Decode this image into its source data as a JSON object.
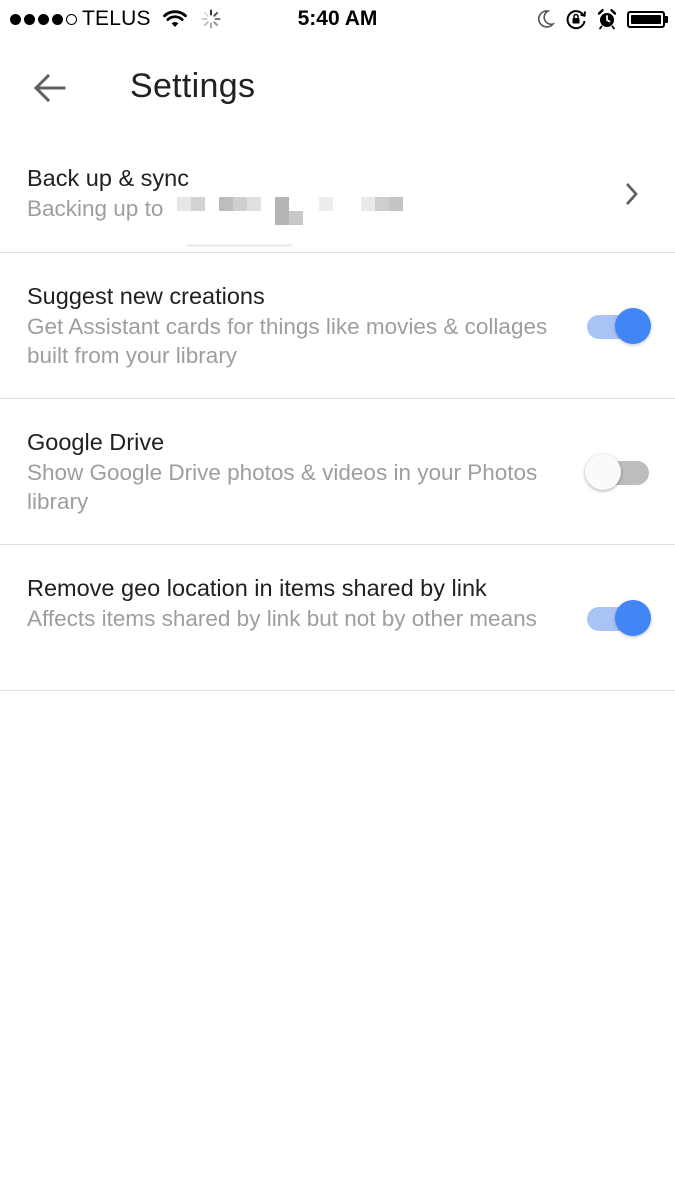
{
  "status_bar": {
    "signal_bars_filled": 4,
    "signal_bars_total": 5,
    "carrier": "TELUS",
    "time": "5:40 AM",
    "icons": [
      "wifi-icon",
      "activity-spinner-icon",
      "moon-icon",
      "rotation-lock-icon",
      "alarm-icon",
      "battery-icon"
    ],
    "battery_level": 1.0
  },
  "app_bar": {
    "back_icon": "arrow-back-icon",
    "title": "Settings"
  },
  "settings": {
    "backup": {
      "title": "Back up & sync",
      "subtitle": "Backing up to",
      "trailing_icon": "chevron-right-icon"
    },
    "suggest": {
      "title": "Suggest new creations",
      "subtitle": "Get Assistant cards for things like movies & collages built from your library",
      "enabled": true
    },
    "drive": {
      "title": "Google Drive",
      "subtitle": "Show Google Drive photos & videos in your Photos library",
      "enabled": false
    },
    "geo": {
      "title": "Remove geo location in items shared by link",
      "subtitle": "Affects items shared by link but not by other means",
      "enabled": true
    }
  },
  "colors": {
    "toggle_on_thumb": "#4285f4",
    "toggle_on_track": "#a9c3f6",
    "toggle_off_thumb": "#fafafa",
    "toggle_off_track": "#bdbdbd",
    "subtitle_text": "#9e9e9e",
    "divider": "#e0e0e0"
  }
}
